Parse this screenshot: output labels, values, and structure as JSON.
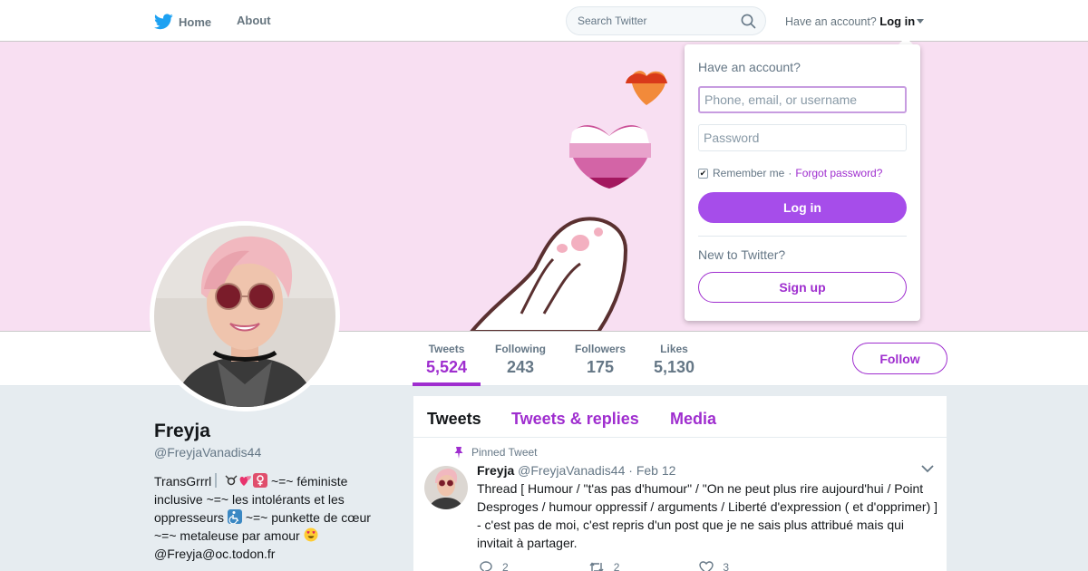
{
  "colors": {
    "accent": "#9f2ecf",
    "banner": "#f8dff2",
    "login_button": "#a64dea"
  },
  "nav": {
    "home_label": "Home",
    "about_label": "About",
    "search_placeholder": "Search Twitter",
    "have_account_text": "Have an account?",
    "login_label": "Log in",
    "icons": [
      "twitter-bird-icon",
      "search-icon",
      "caret-down-icon"
    ]
  },
  "stats": [
    {
      "label": "Tweets",
      "value": "5,524"
    },
    {
      "label": "Following",
      "value": "243"
    },
    {
      "label": "Followers",
      "value": "175"
    },
    {
      "label": "Likes",
      "value": "5,130"
    }
  ],
  "follow_label": "Follow",
  "profile": {
    "name": "Freyja",
    "handle": "@FreyjaVanadis44",
    "bio_parts": [
      "TransGrrrl",
      "~=~ féministe inclusive ~=~ les intolérants et les oppresseurs",
      "~=~ punkette de cœur ~=~ metaleuse par amour",
      "@Freyja@oc.todon.fr"
    ]
  },
  "timeline": {
    "tabs": [
      "Tweets",
      "Tweets & replies",
      "Media"
    ],
    "pinned_label": "Pinned Tweet",
    "tweet": {
      "name": "Freyja",
      "handle": "@FreyjaVanadis44",
      "sep": "·",
      "date": "Feb 12",
      "text": "Thread [ Humour / \"t'as pas d'humour\" / \"On ne peut plus rire aujourd'hui /  Point Desproges / humour oppressif / arguments / Liberté d'expression (  et d'opprimer) ] - c'est pas de moi, c'est repris d'un post que je ne sais plus attribué mais qui invitait à partager.",
      "replies": "2",
      "retweets": "2",
      "likes": "3"
    }
  },
  "login_dropdown": {
    "title": "Have an account?",
    "username_placeholder": "Phone, email, or username",
    "password_placeholder": "Password",
    "remember_label": "Remember me",
    "dot": "·",
    "forgot_label": "Forgot password?",
    "login_button": "Log in",
    "new_label": "New to Twitter?",
    "signup_button": "Sign up"
  }
}
